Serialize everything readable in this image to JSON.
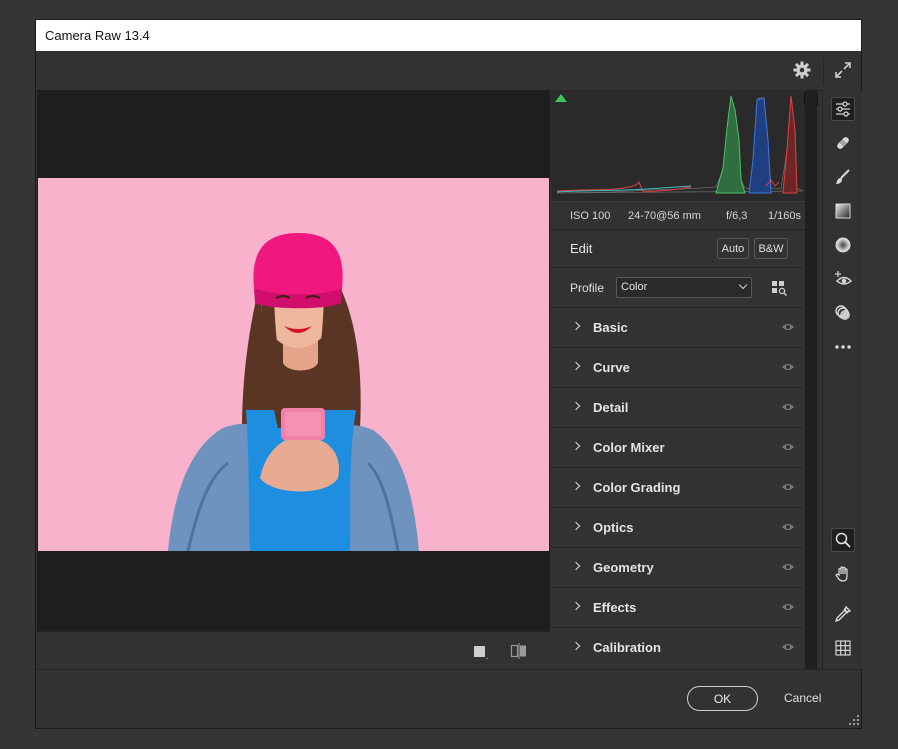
{
  "window": {
    "title": "Camera Raw 13.4"
  },
  "topbar": {
    "icons": [
      "gear-icon",
      "expand-icon"
    ]
  },
  "exif": {
    "iso": "ISO 100",
    "lens": "24-70@56 mm",
    "aperture": "f/6,3",
    "shutter": "1/160s"
  },
  "edit": {
    "title": "Edit",
    "auto_label": "Auto",
    "bw_label": "B&W"
  },
  "profile": {
    "label": "Profile",
    "value": "Color"
  },
  "sections": [
    {
      "label": "Basic"
    },
    {
      "label": "Curve"
    },
    {
      "label": "Detail"
    },
    {
      "label": "Color Mixer"
    },
    {
      "label": "Color Grading"
    },
    {
      "label": "Optics"
    },
    {
      "label": "Geometry"
    },
    {
      "label": "Effects"
    },
    {
      "label": "Calibration"
    }
  ],
  "tools": [
    "edit-sliders-icon",
    "healing-bandage-icon",
    "brush-icon",
    "linear-gradient-icon",
    "radial-filter-icon",
    "red-eye-icon",
    "presets-icon",
    "more-icon",
    "zoom-icon",
    "hand-icon",
    "eyedropper-icon",
    "grid-icon"
  ],
  "footer": {
    "ok_label": "OK",
    "cancel_label": "Cancel"
  },
  "colors": {
    "accent_green": "#3cc45a",
    "photo_background": "#f8b2cb",
    "hat": "#f0177f",
    "top": "#1e8fe0"
  }
}
